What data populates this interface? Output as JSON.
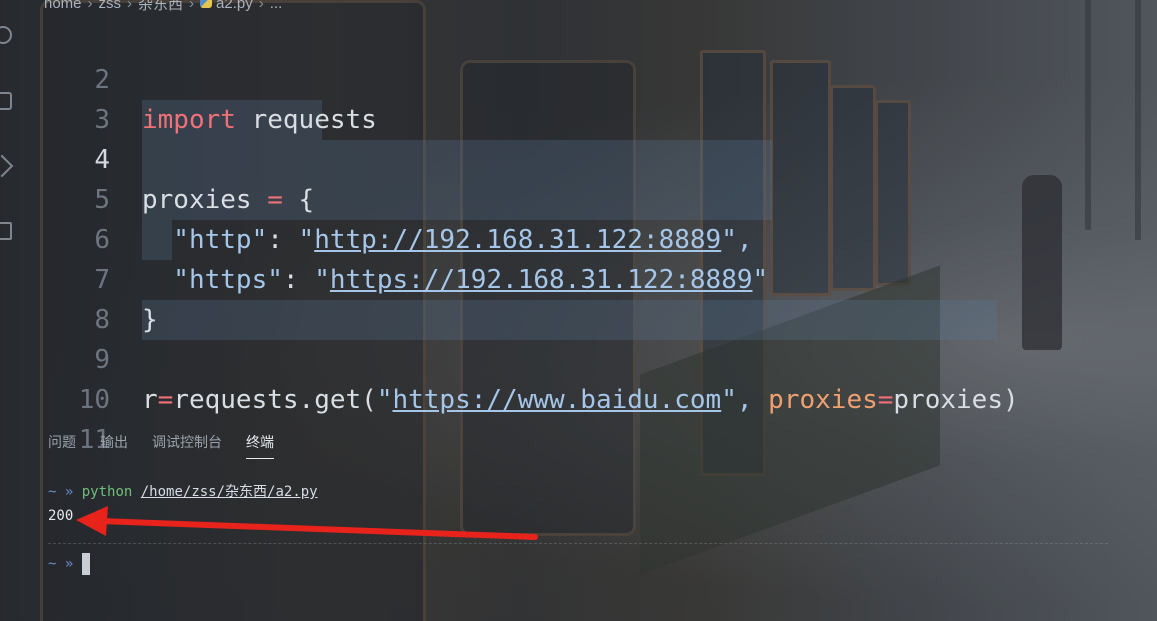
{
  "breadcrumb": {
    "segments": [
      "home",
      "zss",
      "杂东西",
      "a2.py",
      "..."
    ],
    "separator": "›"
  },
  "editor": {
    "lines": [
      {
        "num": "2"
      },
      {
        "num": "3"
      },
      {
        "num": "4"
      },
      {
        "num": "5"
      },
      {
        "num": "6"
      },
      {
        "num": "7"
      },
      {
        "num": "8"
      },
      {
        "num": "9"
      },
      {
        "num": "10"
      },
      {
        "num": "11"
      }
    ],
    "tokens": {
      "import_kw": "import",
      "requests_mod": " requests",
      "proxies_var": "proxies",
      "assign": " = ",
      "brace_open": "{",
      "http_key": "  \"http\"",
      "colon1": ": ",
      "http_quote_open": "\"",
      "http_url": "http://192.168.31.122:8889",
      "http_quote_close": "\",",
      "https_key": "  \"https\"",
      "colon2": ": ",
      "https_quote_open": "\"",
      "https_url": "https://192.168.31.122:8889",
      "https_quote_close": "\"",
      "brace_close": "}",
      "r_var": "r",
      "eq": "=",
      "get_call": "requests.get(",
      "get_quote_open": "\"",
      "baidu_url": "https://www.baidu.com",
      "get_quote_close": "\", ",
      "proxies_param": "proxies",
      "eq2": "=",
      "proxies_arg": "proxies)"
    }
  },
  "panel": {
    "tabs": [
      "问题",
      "输出",
      "调试控制台",
      "终端"
    ],
    "active_tab": "终端"
  },
  "terminal": {
    "prompt": "~ »",
    "command": "python",
    "script_path": "/home/zss/杂东西/a2.py",
    "output": "200",
    "prompt2": "~ »"
  },
  "colors": {
    "keyword": "#f07178",
    "string": "#a5c6e8",
    "param": "#f0a070",
    "annotation_arrow": "#e8231c"
  }
}
